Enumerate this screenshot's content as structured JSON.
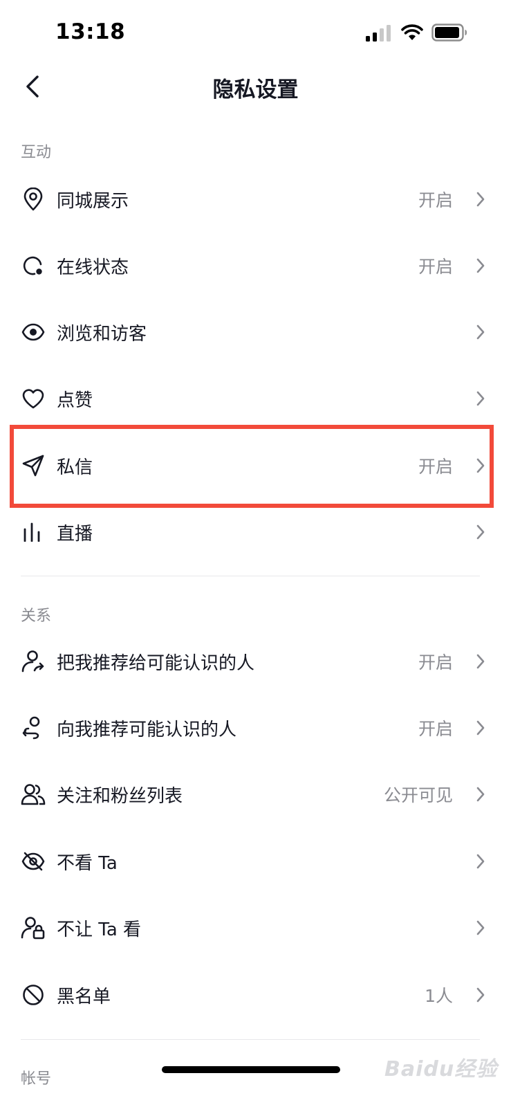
{
  "status_bar": {
    "time": "13:18"
  },
  "nav": {
    "title": "隐私设置"
  },
  "sections": [
    {
      "header": "互动",
      "items": [
        {
          "label": "同城展示",
          "value": "开启",
          "icon": "location-pin-icon"
        },
        {
          "label": "在线状态",
          "value": "开启",
          "icon": "online-status-icon"
        },
        {
          "label": "浏览和访客",
          "value": "",
          "icon": "eye-icon"
        },
        {
          "label": "点赞",
          "value": "",
          "icon": "heart-icon"
        },
        {
          "label": "私信",
          "value": "开启",
          "icon": "paper-plane-icon",
          "highlighted": true
        },
        {
          "label": "直播",
          "value": "",
          "icon": "bar-chart-icon"
        }
      ]
    },
    {
      "header": "关系",
      "items": [
        {
          "label": "把我推荐给可能认识的人",
          "value": "开启",
          "icon": "user-share-icon"
        },
        {
          "label": "向我推荐可能认识的人",
          "value": "开启",
          "icon": "user-recommend-icon"
        },
        {
          "label": "关注和粉丝列表",
          "value": "公开可见",
          "icon": "users-icon"
        },
        {
          "label": "不看 Ta",
          "value": "",
          "icon": "eye-off-icon"
        },
        {
          "label": "不让 Ta 看",
          "value": "",
          "icon": "user-lock-icon"
        },
        {
          "label": "黑名单",
          "value": "1人",
          "icon": "block-icon"
        }
      ]
    },
    {
      "header": "帐号",
      "items": []
    }
  ],
  "watermark": "Baidu经验",
  "colors": {
    "highlight": "#f24a3a",
    "text": "#161823",
    "secondary": "#8a8b91"
  }
}
